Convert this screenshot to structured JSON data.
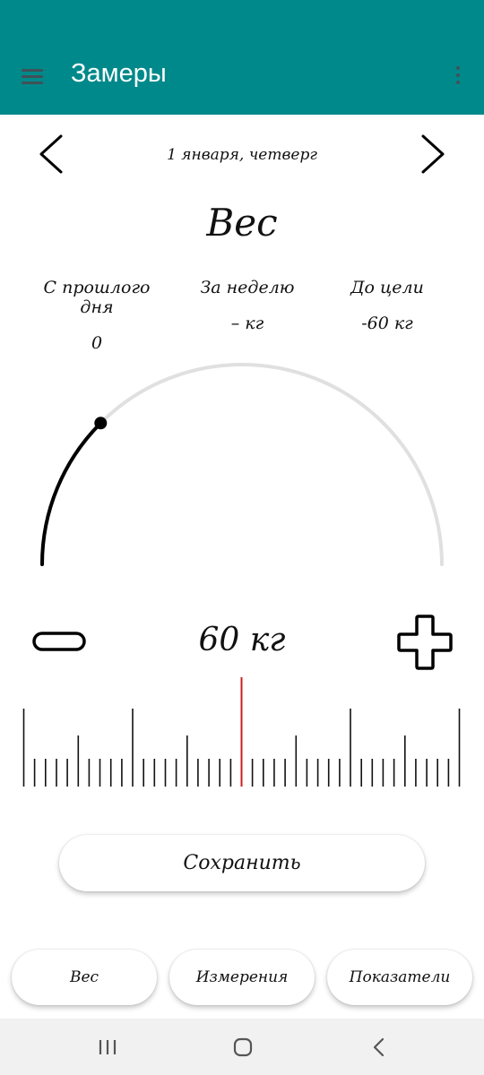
{
  "app_bar": {
    "title": "Замеры",
    "background": "#00898a"
  },
  "date_nav": {
    "date": "1 января, четверг"
  },
  "section": {
    "title": "Вес"
  },
  "stats": [
    {
      "label": "С прошлого дня",
      "value": "0"
    },
    {
      "label": "За неделю",
      "value": "– кг"
    },
    {
      "label": "До цели",
      "value": "-60 кг"
    }
  ],
  "gauge": {
    "progress_fraction": 0.25,
    "track_color": "#e0e0e0",
    "fill_color": "#000000"
  },
  "weight": {
    "display": "60 кг"
  },
  "ruler": {
    "indicator_color": "#cc1f1f"
  },
  "save_button": {
    "label": "Сохранить"
  },
  "bottom_tabs": [
    {
      "label": "Вес"
    },
    {
      "label": "Измерения"
    },
    {
      "label": "Показатели"
    }
  ],
  "icons": {
    "menu": "hamburger-icon",
    "more": "more-vertical-icon",
    "prev": "chevron-left-icon",
    "next": "chevron-right-icon",
    "minus": "minus-icon",
    "plus": "plus-icon"
  }
}
